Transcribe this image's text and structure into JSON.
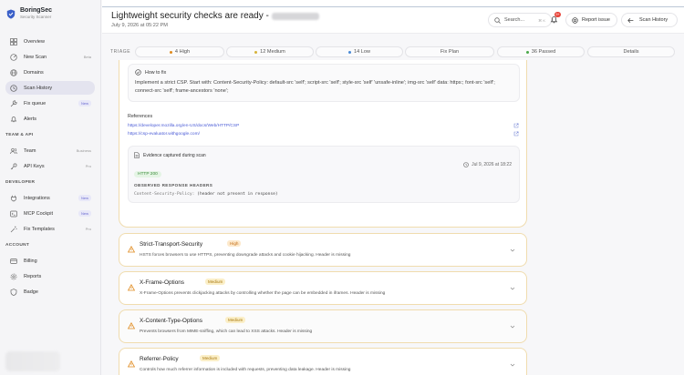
{
  "brand": {
    "name": "BoringSec",
    "subtitle": "Security Scanner"
  },
  "nav": {
    "main": [
      {
        "label": "Overview",
        "icon": "grid-icon",
        "tag": ""
      },
      {
        "label": "New Scan",
        "icon": "radar-icon",
        "tag": "Beta"
      },
      {
        "label": "Domains",
        "icon": "globe-icon",
        "tag": ""
      },
      {
        "label": "Scan History",
        "icon": "history-icon",
        "tag": "",
        "active": true
      },
      {
        "label": "Fix queue",
        "icon": "wrench-icon",
        "tag": "New"
      },
      {
        "label": "Alerts",
        "icon": "bell-icon",
        "tag": ""
      }
    ],
    "team_title": "TEAM & API",
    "team": [
      {
        "label": "Team",
        "icon": "users-icon",
        "tag": "Business"
      },
      {
        "label": "API Keys",
        "icon": "key-icon",
        "tag": "Pro"
      }
    ],
    "dev_title": "DEVELOPER",
    "dev": [
      {
        "label": "Integrations",
        "icon": "plug-icon",
        "tag": "New"
      },
      {
        "label": "MCP Cockpit",
        "icon": "terminal-icon",
        "tag": "New"
      },
      {
        "label": "Fix Templates",
        "icon": "wand-icon",
        "tag": "Pro"
      }
    ],
    "account_title": "ACCOUNT",
    "account": [
      {
        "label": "Billing",
        "icon": "card-icon",
        "tag": ""
      },
      {
        "label": "Reports",
        "icon": "gear-icon",
        "tag": ""
      },
      {
        "label": "Badge",
        "icon": "shield-icon",
        "tag": ""
      }
    ]
  },
  "header": {
    "title": "Lightweight security checks are ready -",
    "date": "July 9, 2026 at 05:22 PM",
    "search_placeholder": "Search...",
    "search_kbd": "⌘ K",
    "notification_count": "9+",
    "report_issue": "Report issue",
    "scan_history": "Scan History"
  },
  "triage": {
    "label": "TRIAGE",
    "high": "4 High",
    "medium": "12 Medium",
    "low": "14 Low",
    "fix_plan": "Fix Plan",
    "passed": "36 Passed",
    "details": "Details"
  },
  "detail": {
    "howto_title": "How to fix",
    "howto_text": "Implement a strict CSP. Start with: Content-Security-Policy: default-src 'self'; script-src 'self'; style-src 'self' 'unsafe-inline'; img-src 'self' data: https:; font-src 'self'; connect-src 'self'; frame-ancestors 'none';",
    "refs_title": "References",
    "refs": [
      "https://developer.mozilla.org/en-US/docs/Web/HTTP/CSP",
      "https://csp-evaluator.withgoogle.com/"
    ],
    "evidence_title": "Evidence captured during scan",
    "evidence_date": "Jul 9, 2026 at 18:22",
    "http_status": "HTTP 200",
    "observed_title": "OBSERVED RESPONSE HEADERS",
    "csp_key": "Content-Security-Policy:",
    "csp_value": "(header not present in response)"
  },
  "findings": [
    {
      "name": "Strict-Transport-Security",
      "severity": "High",
      "desc": "HSTS forces browsers to use HTTPS, preventing downgrade attacks and cookie hijacking. Header is missing"
    },
    {
      "name": "X-Frame-Options",
      "severity": "Medium",
      "desc": "X-Frame-Options prevents clickjacking attacks by controlling whether the page can be embedded in iframes. Header is missing"
    },
    {
      "name": "X-Content-Type-Options",
      "severity": "Medium",
      "desc": "Prevents browsers from MIME-sniffing, which can lead to XSS attacks. Header is missing"
    },
    {
      "name": "Referrer-Policy",
      "severity": "Medium",
      "desc": "Controls how much referrer information is included with requests, preventing data leakage. Header is missing"
    }
  ],
  "colors": {
    "accent": "#4a5bd6",
    "high": "#c26a12",
    "medium": "#a87810",
    "warning": "#e08a1e",
    "active_nav": "#e4e4ef"
  }
}
